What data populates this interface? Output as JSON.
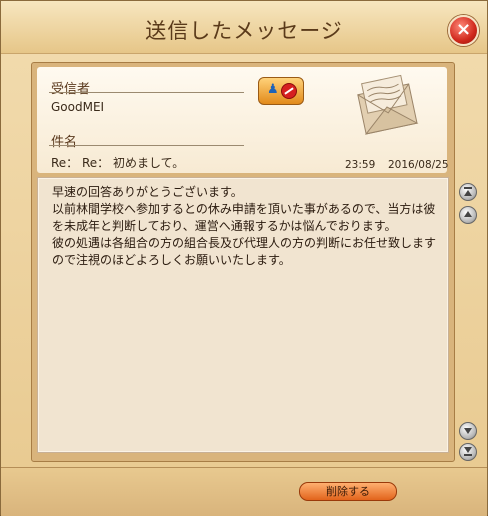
{
  "window": {
    "title": "送信したメッセージ",
    "close_label": "×"
  },
  "header": {
    "recipient_label": "受信者",
    "recipient_value": "GoodMEI",
    "subject_label": "件名",
    "subject_value": "Re： Re： 初めまして。",
    "time": "23:59",
    "date": "2016/08/25",
    "contact_icon": "contact-block-icon",
    "envelope_icon": "envelope-letter-icon"
  },
  "message": {
    "body": "早速の回答ありがとうございます。\n以前林間学校へ参加するとの休み申請を頂いた事があるので、当方は彼を未成年と判断しており、運営へ通報するかは悩んでおります。\n彼の処遇は各組合の方の組合長及び代理人の方の判断にお任せ致しますので注視のほどよろしくお願いいたします。"
  },
  "footer": {
    "delete_label": "削除する"
  }
}
